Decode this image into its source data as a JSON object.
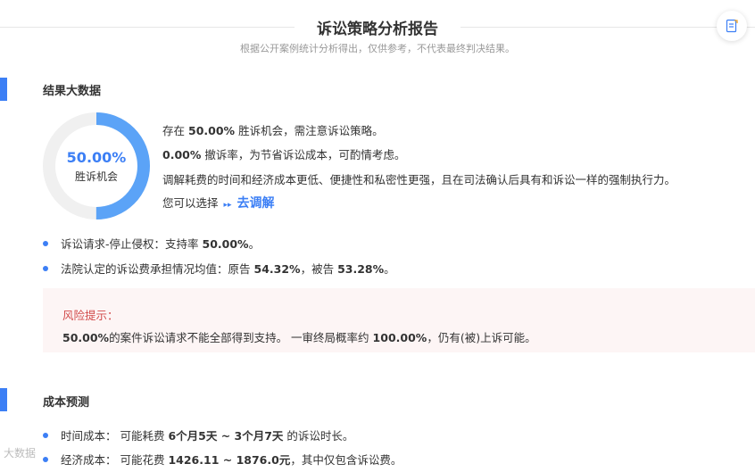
{
  "header": {
    "title": "诉讼策略分析报告",
    "subtitle": "根据公开案例统计分析得出，仅供参考，不代表最终判决结果。",
    "report_icon": "document-edit-icon"
  },
  "result_section": {
    "title": "结果大数据",
    "donut": {
      "percent_text": "50.00%",
      "label": "胜诉机会",
      "value": 0.5,
      "fill_color": "#5ba3f7",
      "track_color": "#f0f0f0"
    },
    "lines": {
      "l1_pre": "存在",
      "l1_val": "50.00%",
      "l1_post": "胜诉机会，需注意诉讼策略。",
      "l2_val": "0.00%",
      "l2_post": "撤诉率，为节省诉讼成本，可酌情考虑。",
      "l3": "调解耗费的时间和经济成本更低、便捷性和私密性更强，且在司法确认后具有和诉讼一样的强制执行力。",
      "l4_pre": "您可以选择",
      "l4_arrows": "▸▸",
      "l4_link": "去调解"
    },
    "bullets": {
      "b1_pre": "诉讼请求-停止侵权：支持率",
      "b1_val": "50.00%",
      "b1_post": "。",
      "b2_pre": "法院认定的诉讼费承担情况均值：原告",
      "b2_val1": "54.32%",
      "b2_mid": "，被告",
      "b2_val2": "53.28%",
      "b2_post": "。"
    },
    "risk": {
      "title": "风险提示：",
      "val1": "50.00%",
      "text1": "的案件诉讼请求不能全部得到支持。 一审终局概率约",
      "val2": "100.00%",
      "text2": "，仍有(被)上诉可能。"
    }
  },
  "cost_section": {
    "title": "成本预测",
    "time_pre": "时间成本： 可能耗费",
    "time_val": "6个月5天 ~ 3个月7天",
    "time_post": "的诉讼时长。",
    "money_pre": "经济成本： 可能花费",
    "money_val": "1426.11 ~ 1876.0元",
    "money_post": "，其中仅包含诉讼费。"
  },
  "watermark": "大数据"
}
